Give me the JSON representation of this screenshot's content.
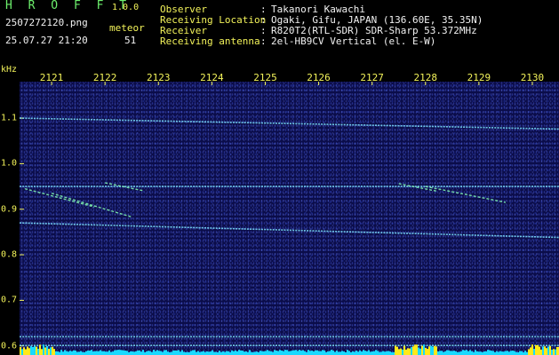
{
  "app": {
    "title": "H R O F F T",
    "version": "1.0.0"
  },
  "capture": {
    "filename": "2507272120.png",
    "datetime": "25.07.27 21:20",
    "meteor_label": "meteor",
    "meteor_count": "51"
  },
  "info": [
    {
      "label": "Observer",
      "value": "Takanori Kawachi"
    },
    {
      "label": "Receiving Location",
      "value": "Ogaki, Gifu, JAPAN (136.60E, 35.35N)"
    },
    {
      "label": "Receiver",
      "value": "R820T2(RTL-SDR) SDR-Sharp 53.372MHz"
    },
    {
      "label": "Receiving antenna",
      "value": "2el-HB9CV Vertical (el. E-W)"
    }
  ],
  "colors": {
    "background": "#000000",
    "label_green": "#6df06d",
    "label_yellow": "#f3f35a",
    "spectrum_background": "#0b0d4a",
    "trace_cyan": "#7fe6ff",
    "level_cyan": "#19d9ff",
    "level_yellow": "#ffe919"
  },
  "chart_data": {
    "type": "heatmap",
    "xunit": "",
    "yunit": "kHz",
    "x_ticks": [
      "2121",
      "2122",
      "2123",
      "2124",
      "2125",
      "2126",
      "2127",
      "2128",
      "2129",
      "2130"
    ],
    "x_range": [
      2120.4,
      2130.5
    ],
    "y_ticks": [
      "1.1",
      "1.0",
      "0.9",
      "0.8",
      "0.7",
      "0.6"
    ],
    "y_range": [
      0.58,
      1.18
    ],
    "traces": [
      {
        "y_start": 1.1,
        "y_end": 1.076
      },
      {
        "y_start": 0.95,
        "y_end": 0.95
      },
      {
        "y_start": 0.87,
        "y_end": 0.838
      },
      {
        "y_start": 0.62,
        "y_end": 0.62
      },
      {
        "y_start": 0.601,
        "y_end": 0.601
      }
    ],
    "meteor_echoes": [
      {
        "x": 2120.5,
        "y_start": 0.945,
        "x_end": 2121.8,
        "y_end": 0.905
      },
      {
        "x": 2121.0,
        "y_start": 0.935,
        "x_end": 2122.5,
        "y_end": 0.883
      },
      {
        "x": 2122.0,
        "y_start": 0.958,
        "x_end": 2122.7,
        "y_end": 0.941
      },
      {
        "x": 2127.5,
        "y_start": 0.956,
        "x_end": 2128.2,
        "y_end": 0.94
      },
      {
        "x": 2128.0,
        "y_start": 0.95,
        "x_end": 2129.5,
        "y_end": 0.915
      }
    ]
  }
}
